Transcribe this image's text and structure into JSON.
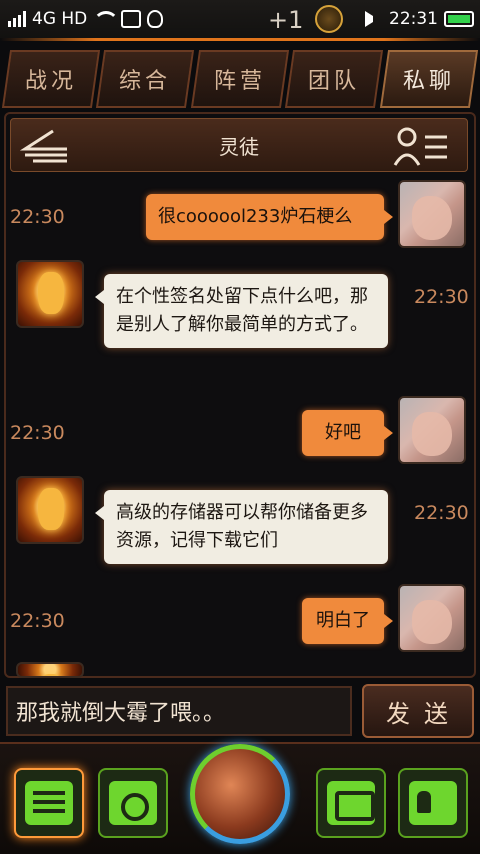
{
  "status_bar": {
    "network": "4G HD",
    "notification_count": "+1",
    "time": "22:31",
    "icons": [
      "signal-icon",
      "wifi-icon",
      "image-icon",
      "qq-icon",
      "coin-icon",
      "mute-icon",
      "battery-icon"
    ],
    "battery_color": "#33d24c"
  },
  "tabs": [
    {
      "label": "战况",
      "active": false
    },
    {
      "label": "综合",
      "active": false
    },
    {
      "label": "阵营",
      "active": false
    },
    {
      "label": "团队",
      "active": false
    },
    {
      "label": "私聊",
      "active": true
    }
  ],
  "chat": {
    "title": "灵徒",
    "messages": [
      {
        "side": "out",
        "time": "22:30",
        "text": "很coooool233炉石梗么"
      },
      {
        "side": "in",
        "time": "22:30",
        "text": "在个性签名处留下点什么吧，那是别人了解你最简单的方式了。"
      },
      {
        "side": "out",
        "time": "22:30",
        "text": "好吧"
      },
      {
        "side": "in",
        "time": "22:30",
        "text": "高级的存储器可以帮你储备更多资源，记得下载它们"
      },
      {
        "side": "out",
        "time": "22:30",
        "text": "明白了"
      }
    ]
  },
  "input": {
    "value": "那我就倒大霉了喂。。",
    "send_label": "发送"
  },
  "bottom_nav": [
    "chat-icon",
    "link-icon",
    "globe-icon",
    "robot-icon",
    "contact-card-icon"
  ],
  "colors": {
    "accent": "#f08a3c",
    "incoming_bubble": "#f1ede2",
    "nav_green": "#6ed62e",
    "timestamp": "#c9895e"
  }
}
